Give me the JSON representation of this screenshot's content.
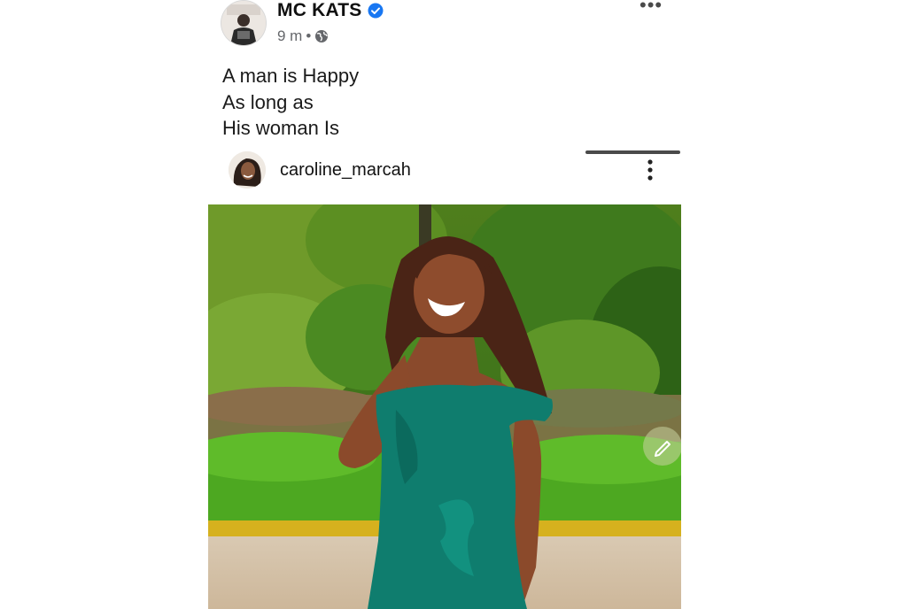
{
  "post": {
    "author": "MC KATS",
    "time": "9 m",
    "separator": "•",
    "audience_icon": "globe-icon",
    "verified_icon": "verified-badge-icon",
    "more_icon": "more-horizontal-icon",
    "more_label": "•••",
    "caption_lines": [
      "A man is Happy",
      "As long as",
      "His woman Is"
    ]
  },
  "shared": {
    "username": "caroline_marcah",
    "more_icon": "more-vertical-icon",
    "photo_icon": "photo",
    "edit_icon": "pencil-icon"
  },
  "colors": {
    "verified": "#1877f2",
    "dress": "#0f7d6e",
    "foliage": "#3c6d1e"
  }
}
